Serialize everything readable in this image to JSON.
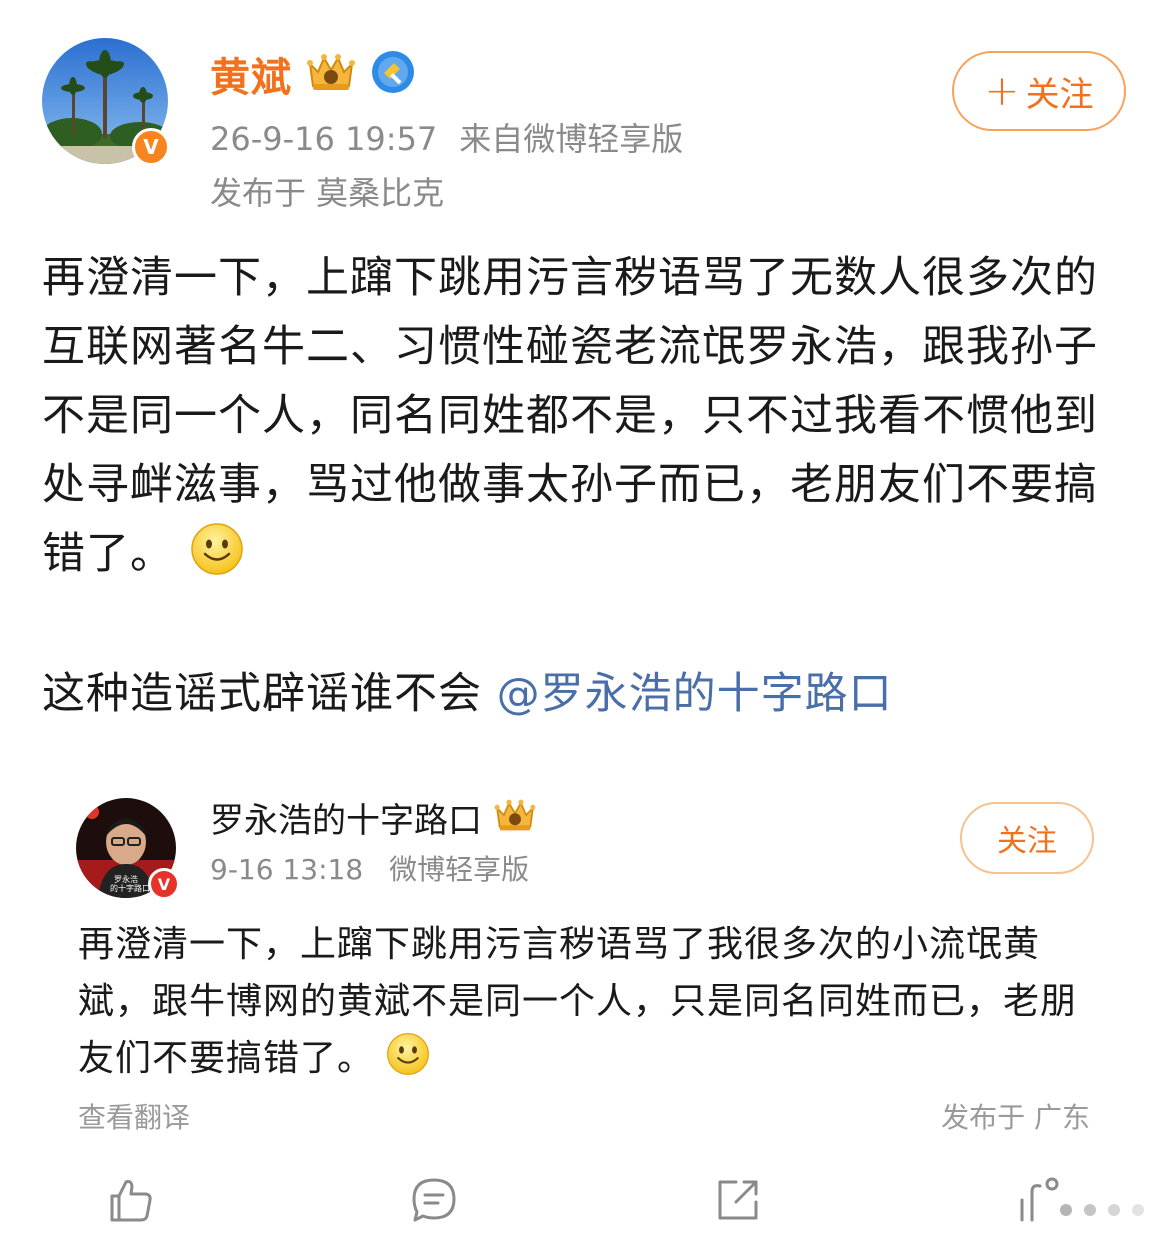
{
  "post": {
    "author": {
      "name": "黄斌",
      "verified_mark": "V",
      "badges": [
        "crown-badge",
        "shield-hammer-badge"
      ]
    },
    "time": "26-9-16 19:57",
    "source": "来自微博轻享版",
    "location": "发布于 莫桑比克",
    "follow_label": "关注",
    "follow_plus": "+",
    "text": "再澄清一下，上蹿下跳用污言秽语骂了无数人很多次的互联网著名牛二、习惯性碰瓷老流氓罗永浩，跟我孙子不是同一个人，同名同姓都不是，只不过我看不惯他到处寻衅滋事，骂过他做事太孙子而已，老朋友们不要搞错了。",
    "text2_prefix": "这种造谣式辟谣谁不会 ",
    "mention": "@罗永浩的十字路口"
  },
  "repost": {
    "author": {
      "name": "罗永浩的十字路口",
      "verified_mark": "V",
      "avatar_caption": "罗永浩 的十字路口"
    },
    "time": "9-16 13:18",
    "source": "微博轻享版",
    "follow_label": "关注",
    "text": "再澄清一下，上蹿下跳用污言秽语骂了我很多次的小流氓黄斌，跟牛博网的黄斌不是同一个人，只是同名同姓而已，老朋友们不要搞错了。",
    "translate_label": "查看翻译",
    "location": "发布于 广东"
  },
  "actions": {
    "icons": [
      "like-icon",
      "comment-icon",
      "share-icon",
      "loading-icon"
    ]
  },
  "colors": {
    "accent": "#f2711c",
    "mention": "#4a6ea8",
    "meta": "#8a8a8a"
  }
}
